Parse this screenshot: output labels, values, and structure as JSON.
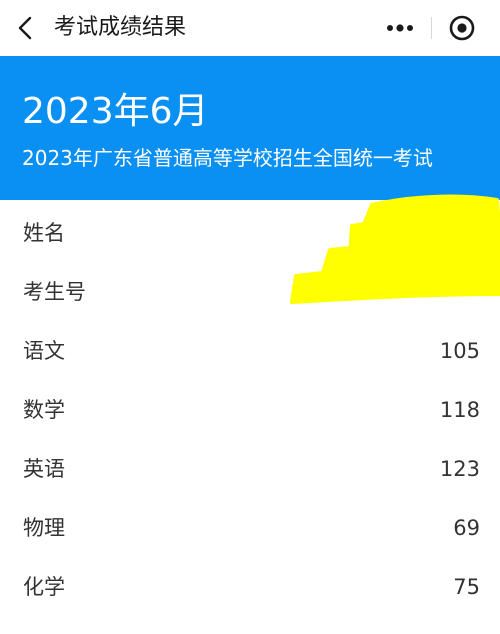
{
  "navbar": {
    "title": "考试成绩结果",
    "back_icon": "chevron-left-icon",
    "more_icon": "more-dots-icon",
    "close_icon": "target-close-icon"
  },
  "header": {
    "date": "2023年6月",
    "exam_name": "2023年广东省普通高等学校招生全国统一考试",
    "background_color": "#0a8ff2"
  },
  "results": [
    {
      "label": "姓名",
      "value": ""
    },
    {
      "label": "考生号",
      "value": ""
    },
    {
      "label": "语文",
      "value": "105"
    },
    {
      "label": "数学",
      "value": "118"
    },
    {
      "label": "英语",
      "value": "123"
    },
    {
      "label": "物理",
      "value": "69"
    },
    {
      "label": "化学",
      "value": "75"
    }
  ],
  "redaction_color": "#ffff00"
}
